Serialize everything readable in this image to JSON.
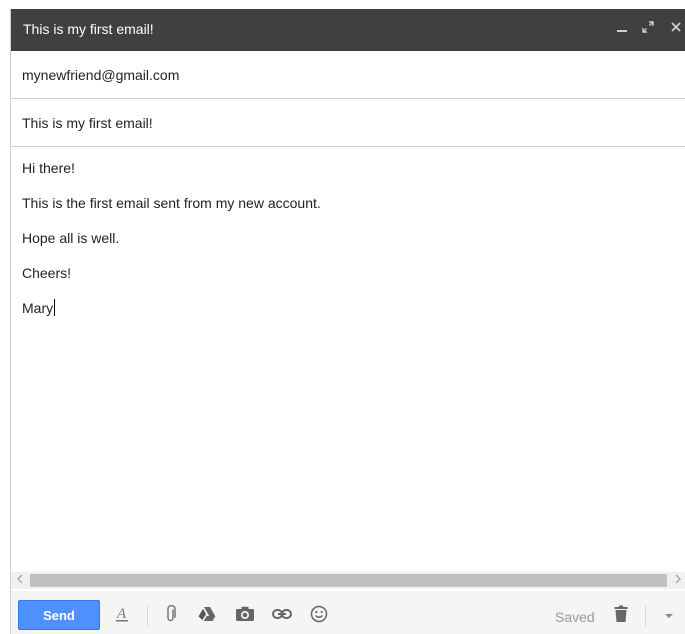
{
  "compose": {
    "title": "This is my first email!",
    "to_value": "mynewfriend@gmail.com",
    "subject_value": "This is my first email!",
    "body_lines": [
      "Hi there!",
      "This is the first email sent from my new account.",
      "Hope all is well.",
      "Cheers!",
      "Mary"
    ],
    "send_label": "Send",
    "saved_label": "Saved"
  },
  "colors": {
    "titlebar_bg": "#404040",
    "send_button_bg": "#4d90fe",
    "toolbar_bg": "#f5f5f5"
  },
  "icons": [
    "minimize-icon",
    "maximize-icon",
    "close-icon",
    "formatting-icon",
    "attach-icon",
    "drive-icon",
    "photo-icon",
    "link-icon",
    "emoji-icon",
    "trash-icon",
    "more-options-icon"
  ]
}
